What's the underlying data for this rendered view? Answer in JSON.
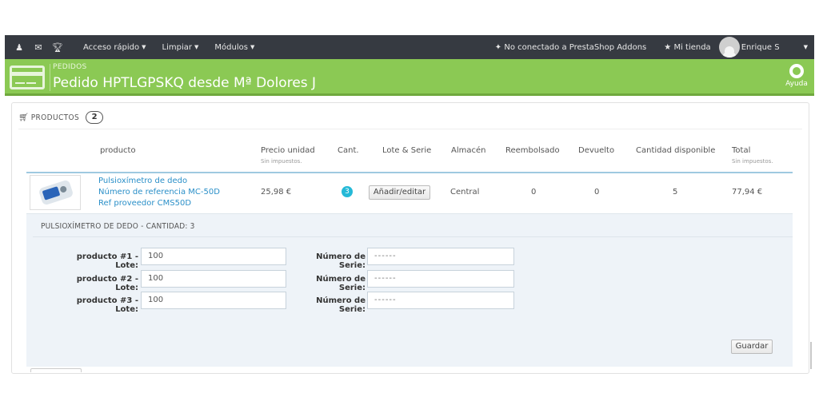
{
  "topbar": {
    "icons": [
      "user-icon",
      "envelope-icon",
      "trophy-icon"
    ],
    "quick_access": "Acceso rápido",
    "clean": "Limpiar",
    "modules": "Módulos",
    "addons_status": "No conectado a PrestaShop Addons",
    "my_shop": "Mi tienda",
    "user_name": "Enrique S"
  },
  "header": {
    "breadcrumb": "PEDIDOS",
    "title": "Pedido HPTLGPSKQ desde Mª Dolores J",
    "help": "Ayuda",
    "color": "#8bc954"
  },
  "products": {
    "heading": "PRODUCTOS",
    "count": "2",
    "columns": {
      "product": "producto",
      "unit_price": "Precio unidad",
      "unit_price_sub": "Sin impuestos.",
      "qty": "Cant.",
      "lot": "Lote & Serie",
      "warehouse": "Almacén",
      "refunded": "Reembolsado",
      "returned": "Devuelto",
      "available": "Cantidad disponible",
      "total": "Total",
      "total_sub": "Sin impuestos."
    },
    "row": {
      "name": "Pulsioxímetro de dedo",
      "reference": "Número de referencia MC-50D",
      "supplier_ref": "Ref proveedor CMS50D",
      "unit_price": "25,98 €",
      "qty": "3",
      "edit_button": "Añadir/editar",
      "warehouse": "Central",
      "refunded": "0",
      "returned": "0",
      "available": "5",
      "total": "77,94 €"
    }
  },
  "lots": {
    "caption": "PULSIOXÍMETRO DE DEDO - CANTIDAD: 3",
    "serial_label": "Número de Serie:",
    "rows": [
      {
        "label": "producto #1 - Lote:",
        "lot": "100",
        "serial": "------"
      },
      {
        "label": "producto #2 - Lote:",
        "lot": "100",
        "serial": "------"
      },
      {
        "label": "producto #3 - Lote:",
        "lot": "100",
        "serial": "------"
      }
    ],
    "save_button": "Guardar"
  }
}
